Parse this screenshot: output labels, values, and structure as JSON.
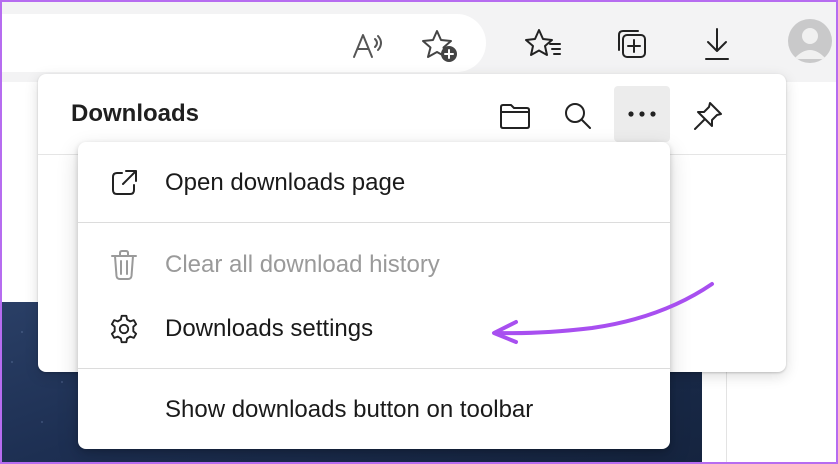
{
  "downloads_panel": {
    "title": "Downloads"
  },
  "context_menu": {
    "items": [
      {
        "label": "Open downloads page",
        "icon": "open-external-icon",
        "enabled": true
      },
      {
        "label": "Clear all download history",
        "icon": "trash-icon",
        "enabled": false
      },
      {
        "label": "Downloads settings",
        "icon": "gear-icon",
        "enabled": true
      },
      {
        "label": "Show downloads button on toolbar",
        "icon": "",
        "enabled": true
      }
    ]
  },
  "toolbar_icons": [
    "read-aloud-icon",
    "add-favorite-icon",
    "favorites-icon",
    "collections-icon",
    "downloads-icon",
    "profile-avatar"
  ],
  "panel_icons": [
    "folder-icon",
    "search-icon",
    "more-icon",
    "pin-icon"
  ],
  "colors": {
    "frame_border": "#b66cf0",
    "annotation_arrow": "#a84ff0",
    "disabled_text": "#9a9a9a"
  }
}
